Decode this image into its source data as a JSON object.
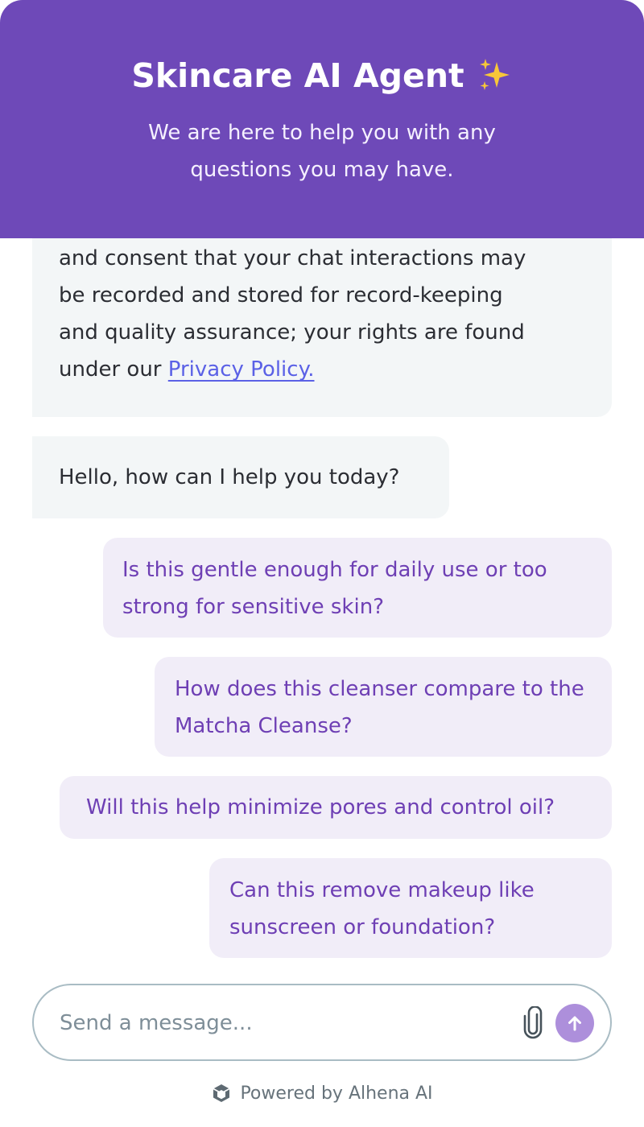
{
  "header": {
    "title": "Skincare AI Agent",
    "title_icon": "sparkles-icon",
    "subtitle": "We are here to help you with any questions you may have."
  },
  "messages": {
    "consent": {
      "text_lines": [
        "and consent that your chat interactions may",
        "be recorded and stored for record-keeping",
        "and quality assurance; your rights are found"
      ],
      "prefix": "under our ",
      "link_label": "Privacy Policy."
    },
    "greeting": "Hello, how can I help you today?",
    "suggestions": [
      "Is this gentle enough for daily use or too strong for sensitive skin?",
      "How does this cleanser compare to the Matcha Cleanse?",
      "Will this help minimize pores and control oil?",
      "Can this remove makeup like sunscreen or foundation?"
    ]
  },
  "composer": {
    "placeholder": "Send a message...",
    "attach_icon": "paperclip-icon",
    "send_icon": "arrow-up-icon"
  },
  "footer": {
    "label": "Powered by Alhena AI",
    "logo_icon": "alhena-logo-icon"
  },
  "colors": {
    "header_bg": "#6e49b8",
    "bot_bubble_bg": "#f3f6f7",
    "user_bubble_bg": "#f1edf8",
    "user_text": "#6e3fb4",
    "send_button": "#ad8fdb",
    "link": "#5b61e6"
  }
}
